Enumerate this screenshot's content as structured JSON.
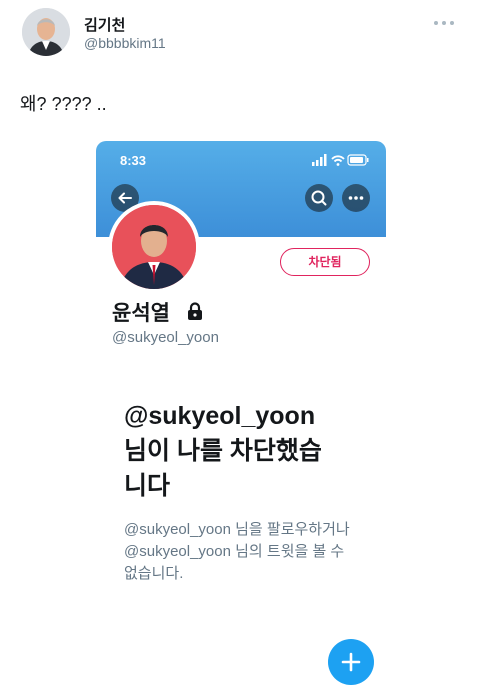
{
  "tweet": {
    "author_name": "김기천",
    "author_handle": "@bbbbkim11",
    "text": "왜? ???? .."
  },
  "screenshot": {
    "status_time": "8:33",
    "profile_name": "윤석열",
    "profile_handle": "@sukyeol_yoon",
    "blocked_button_label": "차단됨",
    "blocked_title": "@sukyeol_yoon 님이 나를 차단했습니다",
    "blocked_description": "@sukyeol_yoon 님을 팔로우하거나 @sukyeol_yoon 님의 트윗을 볼 수 없습니다."
  },
  "icons": {
    "back": "back-arrow-icon",
    "search": "search-icon",
    "more": "more-horizontal-icon",
    "lock": "lock-icon",
    "compose": "plus-icon"
  },
  "colors": {
    "twitter_blue": "#1da1f2",
    "blocked_red": "#e0245e",
    "secondary_text": "#657786"
  }
}
